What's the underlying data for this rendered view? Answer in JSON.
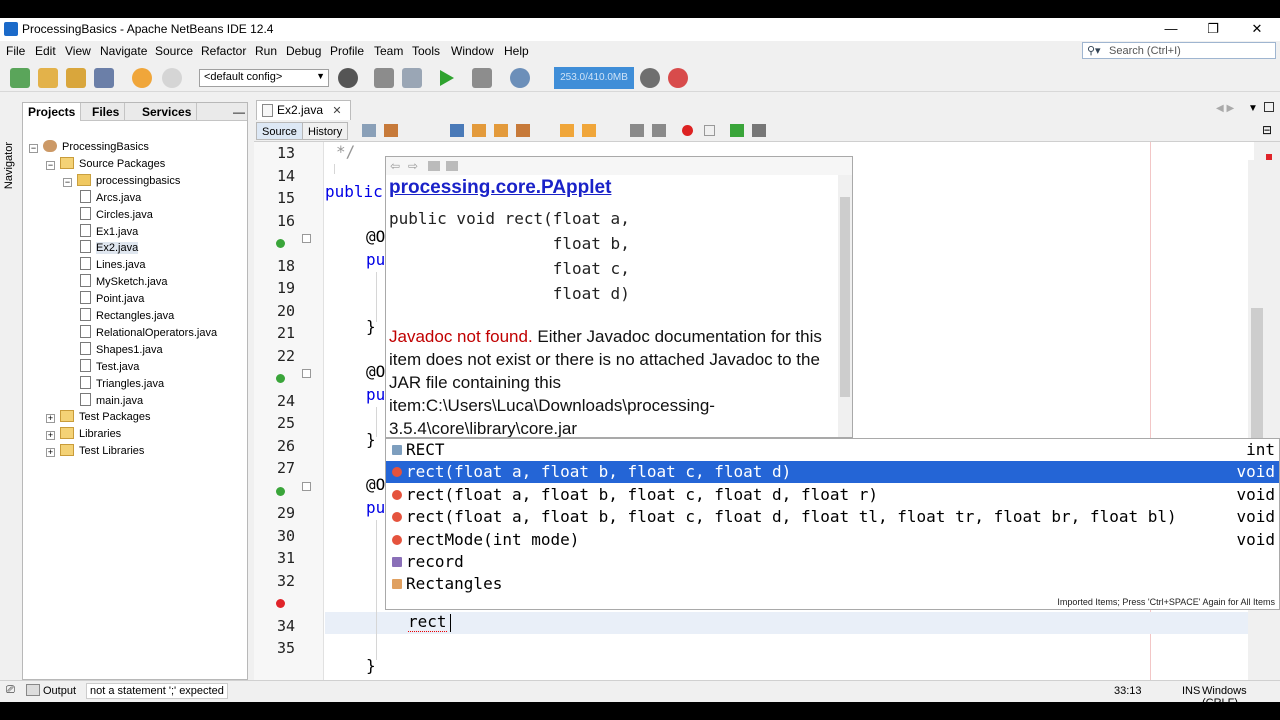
{
  "window": {
    "title": "ProcessingBasics - Apache NetBeans IDE 12.4",
    "controls": [
      "—",
      "❐",
      "✕"
    ]
  },
  "menu": [
    "File",
    "Edit",
    "View",
    "Navigate",
    "Source",
    "Refactor",
    "Run",
    "Debug",
    "Profile",
    "Team",
    "Tools",
    "Window",
    "Help"
  ],
  "search": {
    "placeholder": "Search (Ctrl+I)"
  },
  "toolbar": {
    "config": "<default config>",
    "memory": "253.0/410.0MB"
  },
  "left_panel": {
    "tabs": [
      "Projects",
      "Files",
      "Services"
    ],
    "navigator_label": "Navigator",
    "tree": [
      {
        "label": "ProcessingBasics",
        "level": 0,
        "kind": "proj",
        "toggle": "−"
      },
      {
        "label": "Source Packages",
        "level": 1,
        "kind": "folder",
        "toggle": "−"
      },
      {
        "label": "processingbasics",
        "level": 2,
        "kind": "pkg",
        "toggle": "−"
      },
      {
        "label": "Arcs.java",
        "level": 3,
        "kind": "java"
      },
      {
        "label": "Circles.java",
        "level": 3,
        "kind": "java"
      },
      {
        "label": "Ex1.java",
        "level": 3,
        "kind": "java"
      },
      {
        "label": "Ex2.java",
        "level": 3,
        "kind": "java",
        "selected": true
      },
      {
        "label": "Lines.java",
        "level": 3,
        "kind": "java"
      },
      {
        "label": "MySketch.java",
        "level": 3,
        "kind": "java"
      },
      {
        "label": "Point.java",
        "level": 3,
        "kind": "java"
      },
      {
        "label": "Rectangles.java",
        "level": 3,
        "kind": "java"
      },
      {
        "label": "RelationalOperators.java",
        "level": 3,
        "kind": "java"
      },
      {
        "label": "Shapes1.java",
        "level": 3,
        "kind": "java"
      },
      {
        "label": "Test.java",
        "level": 3,
        "kind": "java"
      },
      {
        "label": "Triangles.java",
        "level": 3,
        "kind": "java"
      },
      {
        "label": "main.java",
        "level": 3,
        "kind": "java"
      },
      {
        "label": "Test Packages",
        "level": 1,
        "kind": "folder",
        "toggle": "+"
      },
      {
        "label": "Libraries",
        "level": 1,
        "kind": "folder",
        "toggle": "+"
      },
      {
        "label": "Test Libraries",
        "level": 1,
        "kind": "folder",
        "toggle": "+"
      }
    ]
  },
  "editor": {
    "tab_label": "Ex2.java",
    "source_tab": "Source",
    "history_tab": "History",
    "line_numbers": [
      "13",
      "14",
      "15",
      "16",
      "",
      "18",
      "19",
      "20",
      "21",
      "22",
      "",
      "24",
      "25",
      "26",
      "27",
      "",
      "29",
      "30",
      "31",
      "32",
      "",
      "34",
      "35"
    ],
    "code_fragments": [
      "*/",
      "public",
      "@O",
      "pu",
      "}",
      "@O",
      "pu",
      "}",
      "@O",
      "pu",
      "}"
    ],
    "typed_text": "rect"
  },
  "javadoc": {
    "class_name": "processing.core.PApplet",
    "signature": [
      "public void rect(float a,",
      "                 float b,",
      "                 float c,",
      "                 float d)"
    ],
    "message_red": "Javadoc not found.",
    "message_rest": "Either Javadoc documentation for this item does not exist or there is no attached Javadoc to the JAR file containing this item:C:\\Users\\Luca\\Downloads\\processing-3.5.4\\core\\library\\core.jar"
  },
  "completion": {
    "items": [
      {
        "text": "RECT",
        "type": "int",
        "icon": "sq"
      },
      {
        "text": "rect(float a, float b, float c, float d)",
        "type": "void",
        "icon": "m",
        "selected": true
      },
      {
        "text": "rect(float a, float b, float c, float d, float r)",
        "type": "void",
        "icon": "m"
      },
      {
        "text": "rect(float a, float b, float c, float d, float tl, float tr, float br, float bl)",
        "type": "void",
        "icon": "m"
      },
      {
        "text": "rectMode(int mode)",
        "type": "void",
        "icon": "m"
      },
      {
        "text": "record",
        "type": "",
        "icon": "rec"
      },
      {
        "text": "Rectangles",
        "type": "",
        "icon": "cls"
      }
    ],
    "footer": "Imported Items; Press 'Ctrl+SPACE' Again for All Items"
  },
  "status": {
    "output_label": "Output",
    "message": "not a statement ';' expected",
    "position": "33:13",
    "mode": "INS",
    "line_endings": "Windows (CRLF)"
  },
  "colors": {
    "selection": "#2465d6",
    "error": "#c00000",
    "link": "#1a22c8"
  }
}
